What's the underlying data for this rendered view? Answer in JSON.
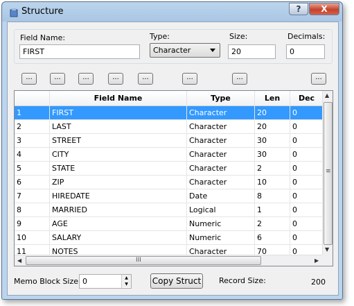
{
  "window": {
    "title": "Structure",
    "help_label": "?",
    "close_label": "X"
  },
  "field_editor": {
    "field_name_label": "Field Name:",
    "field_name_value": "FIRST",
    "type_label": "Type:",
    "type_value": "Character",
    "size_label": "Size:",
    "size_value": "20",
    "decimals_label": "Decimals:",
    "decimals_value": "0"
  },
  "ellipsis_buttons": [
    "...",
    "...",
    "...",
    "...",
    "...",
    "...",
    "...",
    "..."
  ],
  "grid": {
    "columns": [
      "",
      "Field Name",
      "Type",
      "Len",
      "Dec"
    ],
    "selected_row": 0,
    "rows": [
      [
        "1",
        "FIRST",
        "Character",
        "20",
        "0"
      ],
      [
        "2",
        "LAST",
        "Character",
        "20",
        "0"
      ],
      [
        "3",
        "STREET",
        "Character",
        "30",
        "0"
      ],
      [
        "4",
        "CITY",
        "Character",
        "30",
        "0"
      ],
      [
        "5",
        "STATE",
        "Character",
        "2",
        "0"
      ],
      [
        "6",
        "ZIP",
        "Character",
        "10",
        "0"
      ],
      [
        "7",
        "HIREDATE",
        "Date",
        "8",
        "0"
      ],
      [
        "8",
        "MARRIED",
        "Logical",
        "1",
        "0"
      ],
      [
        "9",
        "AGE",
        "Numeric",
        "2",
        "0"
      ],
      [
        "10",
        "SALARY",
        "Numeric",
        "6",
        "0"
      ],
      [
        "11",
        "NOTES",
        "Character",
        "70",
        "0"
      ]
    ],
    "vscroll_grip": "≡",
    "hscroll_grip": "III"
  },
  "footer": {
    "memo_label": "Memo Block Size:",
    "memo_value": "0",
    "copy_button": "Copy Struct",
    "record_size_label": "Record Size:",
    "record_size_value": "200"
  },
  "colors": {
    "selection": "#3399ff",
    "close_button": "#c4432a",
    "dialog_background": "#f0f0f0"
  }
}
